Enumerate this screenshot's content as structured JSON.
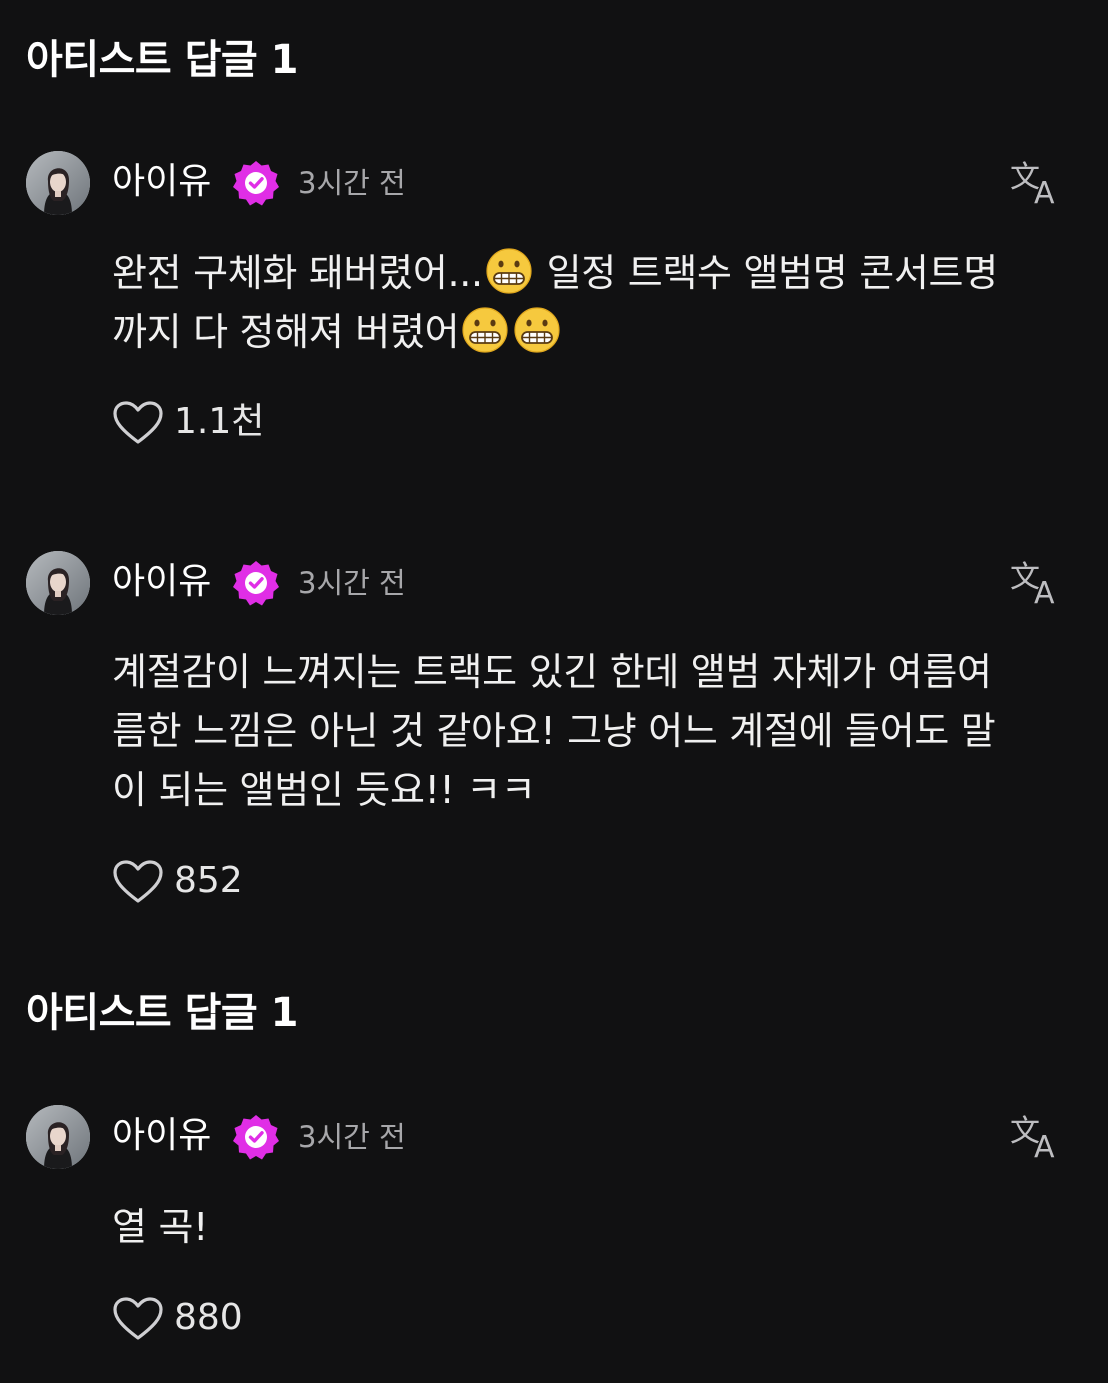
{
  "sections": [
    {
      "title": "아티스트 답글 1"
    },
    {
      "title": "아티스트 답글 1"
    }
  ],
  "comments": [
    {
      "author": "아이유",
      "time": "3시간 전",
      "line1_a": "완전 구체화 돼버렸어...",
      "line1_b": " 일정 트랙수 앨범명 콘서트명",
      "line2_a": "까지 다 정해져 버렸어",
      "likes": "1.1천"
    },
    {
      "author": "아이유",
      "time": "3시간 전",
      "line1": "계절감이 느껴지는 트랙도 있긴 한데 앨범 자체가 여름여",
      "line2": "름한 느낌은 아닌 것 같아요! 그냥 어느 계절에 들어도 말",
      "line3": "이 되는 앨범인 듯요!! ㅋㅋ",
      "likes": "852"
    },
    {
      "author": "아이유",
      "time": "3시간 전",
      "line1": "열 곡!",
      "likes": "880"
    }
  ],
  "icons": {
    "verified_badge": "verified-badge-icon",
    "translate": "translate-icon",
    "like": "heart-icon",
    "emoji": "grimacing-face-emoji"
  },
  "colors": {
    "background": "#111112",
    "badge": "#e02ee6",
    "text": "#f0f0f0",
    "muted": "#a7a7aa"
  }
}
